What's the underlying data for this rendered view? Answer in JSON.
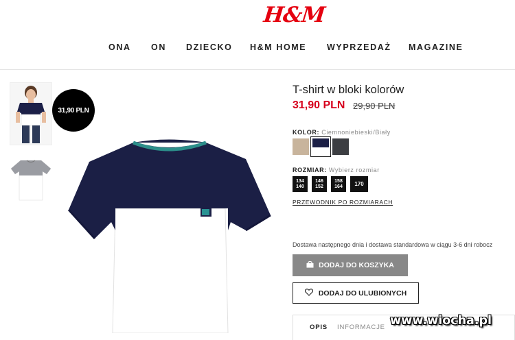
{
  "brand": {
    "logo_text": "H&M",
    "color": "#e50010"
  },
  "nav": {
    "items": [
      "ONA",
      "ON",
      "DZIECKO",
      "H&M HOME",
      "WYPRZEDAŻ",
      "MAGAZINE"
    ]
  },
  "price_bubble": "31,90 PLN",
  "product": {
    "title": "T-shirt w bloki kolorów",
    "price_current": "31,90 PLN",
    "price_old": "29,90 PLN",
    "price_color": "#d6001c"
  },
  "color_section": {
    "label": "KOLOR:",
    "value": "Ciemnoniebieski/Biały",
    "swatches": [
      {
        "name": "beige",
        "color": "#c8b49c",
        "selected": false
      },
      {
        "name": "navy-white",
        "color": "#1b1f45",
        "selected": true
      },
      {
        "name": "dark-grey",
        "color": "#3c3e42",
        "selected": false
      }
    ]
  },
  "size_section": {
    "label": "ROZMIAR:",
    "value": "Wybierz rozmiar",
    "sizes": [
      {
        "top": "134",
        "bottom": "140"
      },
      {
        "top": "146",
        "bottom": "152"
      },
      {
        "top": "158",
        "bottom": "164"
      },
      {
        "top": "170",
        "bottom": ""
      }
    ],
    "guide_link": "PRZEWODNIK PO ROZMIARACH"
  },
  "delivery_text": "Dostawa następnego dnia i dostawa standardowa w ciągu 3-6 dni robocz",
  "buttons": {
    "add_to_cart": "DODAJ DO KOSZYKA",
    "add_to_favorites": "DODAJ DO ULUBIONYCH"
  },
  "tabs": [
    {
      "label": "OPIS",
      "active": true
    },
    {
      "label": "INFORMACJE",
      "active": false
    }
  ],
  "watermark": "www.wiocha.pl"
}
